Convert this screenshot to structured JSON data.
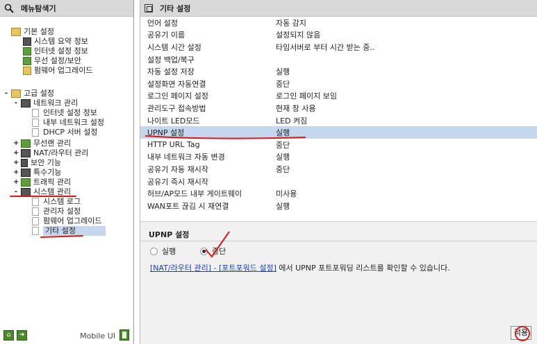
{
  "left_panel": {
    "title": "메뉴탐색기",
    "bottom": {
      "mobile_label": "Mobile UI"
    }
  },
  "tree": {
    "basic": {
      "label": "기본 설정",
      "items": [
        {
          "label": "시스템 요약 정보"
        },
        {
          "label": "인터넷 설정 정보"
        },
        {
          "label": "무선 설정/보안"
        },
        {
          "label": "펌웨어 업그레이드"
        }
      ]
    },
    "advanced": {
      "label": "고급 설정",
      "toggle": "-"
    },
    "network": {
      "label": "네트워크 관리",
      "toggle": "-",
      "items": [
        {
          "label": "인터넷 설정 정보"
        },
        {
          "label": "내부 네트워크 설정"
        },
        {
          "label": "DHCP 서버 설정"
        }
      ]
    },
    "groups": [
      {
        "label": "무선랜 관리",
        "toggle": "+"
      },
      {
        "label": "NAT/라우터 관리",
        "toggle": "+"
      },
      {
        "label": "보안 기능",
        "toggle": "+"
      },
      {
        "label": "특수기능",
        "toggle": "+"
      },
      {
        "label": "트래픽 관리",
        "toggle": "+"
      }
    ],
    "system": {
      "label": "시스템 관리",
      "toggle": "-",
      "items": [
        {
          "label": "시스템 로그"
        },
        {
          "label": "관리자 설정"
        },
        {
          "label": "펌웨어 업그레이드"
        },
        {
          "label": "기타 설정"
        }
      ]
    }
  },
  "right_panel": {
    "title": "기타 설정"
  },
  "settings": [
    {
      "key": "언어 설정",
      "value": "자동 감지"
    },
    {
      "key": "공유기 이름",
      "value": "설정되지 않음"
    },
    {
      "key": "시스템 시간 설정",
      "value": "타임서버로 부터 시간 받는 중.."
    },
    {
      "key": "설정 백업/복구",
      "value": ""
    },
    {
      "key": "자동 설정 저장",
      "value": "실행"
    },
    {
      "key": "설정화면 자동연결",
      "value": "중단"
    },
    {
      "key": "로그인 페이지 설정",
      "value": "로그인 페이지 보임"
    },
    {
      "key": "관리도구 접속방법",
      "value": "현재 창 사용"
    },
    {
      "key": "나이트 LED모드",
      "value": "LED 켜짐"
    },
    {
      "key": "UPNP 설정",
      "value": "실행"
    },
    {
      "key": "HTTP URL Tag",
      "value": "중단"
    },
    {
      "key": "내부 네트워크 자동 변경",
      "value": "실행"
    },
    {
      "key": "공유기 자동 재시작",
      "value": "중단"
    },
    {
      "key": "공유기 즉시 재시작",
      "value": ""
    },
    {
      "key": "허브/AP모드 내부 게이트웨이",
      "value": "미사용"
    },
    {
      "key": "WAN포트 끊김 시 재연결",
      "value": "실행"
    }
  ],
  "detail": {
    "title": "UPNP 설정",
    "options": [
      {
        "label": "실행"
      },
      {
        "label": "중단"
      }
    ],
    "link_text": "[NAT/라우터 관리] - [포트포워드 설정]",
    "notice_text": " 에서 UPNP 포트포워딩 리스트를 확인할 수 있습니다.",
    "apply_label": "적용"
  }
}
